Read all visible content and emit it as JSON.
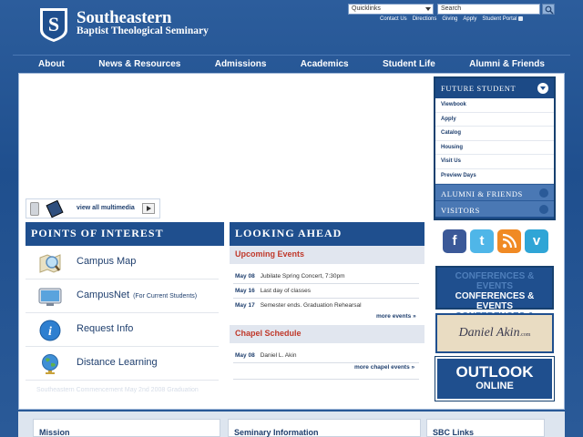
{
  "header": {
    "brand_line1": "Southeastern",
    "brand_line2": "Baptist Theological Seminary",
    "quicklinks_label": "Quicklinks",
    "search_placeholder": "Search",
    "top_links": [
      "Contact Us",
      "Directions",
      "Giving",
      "Apply",
      "Student Portal"
    ]
  },
  "nav": {
    "items": [
      "About",
      "News & Resources",
      "Admissions",
      "Academics",
      "Student Life",
      "Alumni & Friends"
    ]
  },
  "media": {
    "view_all_label": "view all multimedia"
  },
  "points_of_interest": {
    "title": "POINTS OF INTEREST",
    "items": [
      {
        "label": "Campus Map",
        "sub": ""
      },
      {
        "label": "CampusNet",
        "sub": "(For Current Students)"
      },
      {
        "label": "Request Info",
        "sub": ""
      },
      {
        "label": "Distance Learning",
        "sub": ""
      }
    ]
  },
  "looking_ahead": {
    "title": "LOOKING AHEAD",
    "upcoming_title": "Upcoming Events",
    "events": [
      {
        "date": "May 08",
        "text": "Jubilate Spring Concert, 7:30pm"
      },
      {
        "date": "May 16",
        "text": "Last day of classes"
      },
      {
        "date": "May 17",
        "text": "Semester ends. Graduation Rehearsal"
      }
    ],
    "more_events": "more events »",
    "chapel_title": "Chapel Schedule",
    "chapel": [
      {
        "date": "May 08",
        "text": "Daniel L. Akin"
      }
    ],
    "more_chapel": "more chapel events »"
  },
  "sidebar": {
    "future_title": "FUTURE STUDENT",
    "future_items": [
      "Viewbook",
      "Apply",
      "Catalog",
      "Housing",
      "Visit Us",
      "Preview Days"
    ],
    "alumni_title": "ALUMNI & FRIENDS",
    "visitors_title": "VISITORS"
  },
  "social": {
    "icons": [
      "facebook-icon",
      "twitter-icon",
      "rss-icon",
      "vimeo-icon"
    ]
  },
  "promos": {
    "conferences": "CONFERENCES & EVENTS",
    "akin": "Daniel Akin",
    "akin_domain": ".com",
    "outlook_1": "OUTLOOK",
    "outlook_2": "ONLINE"
  },
  "bottom": {
    "cards": [
      "Mission",
      "Seminary Information",
      "SBC Links"
    ]
  },
  "ghost_text": "Southeastern Commencement May 2nd 2008 Graduation"
}
